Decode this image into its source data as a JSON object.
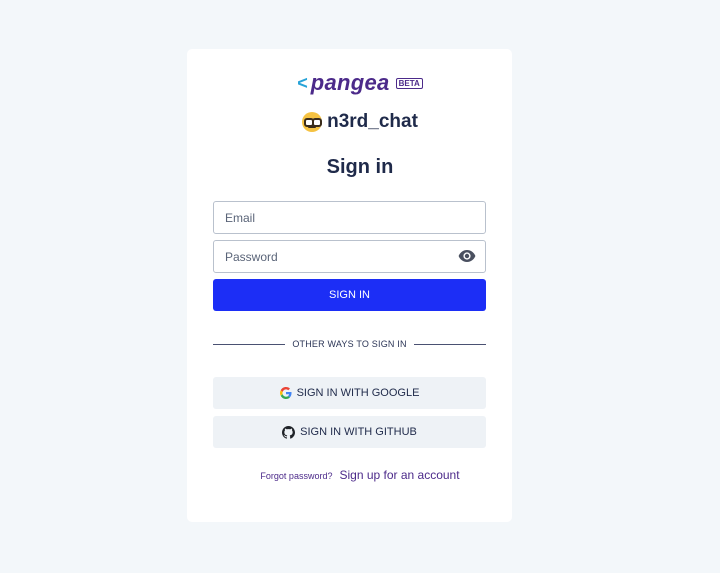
{
  "brand": {
    "logo_text": "pangea",
    "badge": "BETA",
    "accent": "#4c2a8a",
    "chevron_color": "#27a3d8"
  },
  "app": {
    "name": "n3rd_chat",
    "emoji_icon": "nerd-face-icon"
  },
  "page": {
    "title": "Sign in"
  },
  "form": {
    "email_placeholder": "Email",
    "email_value": "",
    "password_placeholder": "Password",
    "password_value": "",
    "toggle_icon": "eye-icon",
    "submit_label": "SIGN IN",
    "submit_color": "#1c2ef6"
  },
  "divider": {
    "label": "OTHER WAYS TO SIGN IN"
  },
  "social": {
    "google_label": "SIGN IN WITH GOOGLE",
    "google_icon": "google-icon",
    "github_label": "SIGN IN WITH GITHUB",
    "github_icon": "github-icon"
  },
  "links": {
    "forgot_password": "Forgot password?",
    "sign_up": "Sign up for an account"
  }
}
